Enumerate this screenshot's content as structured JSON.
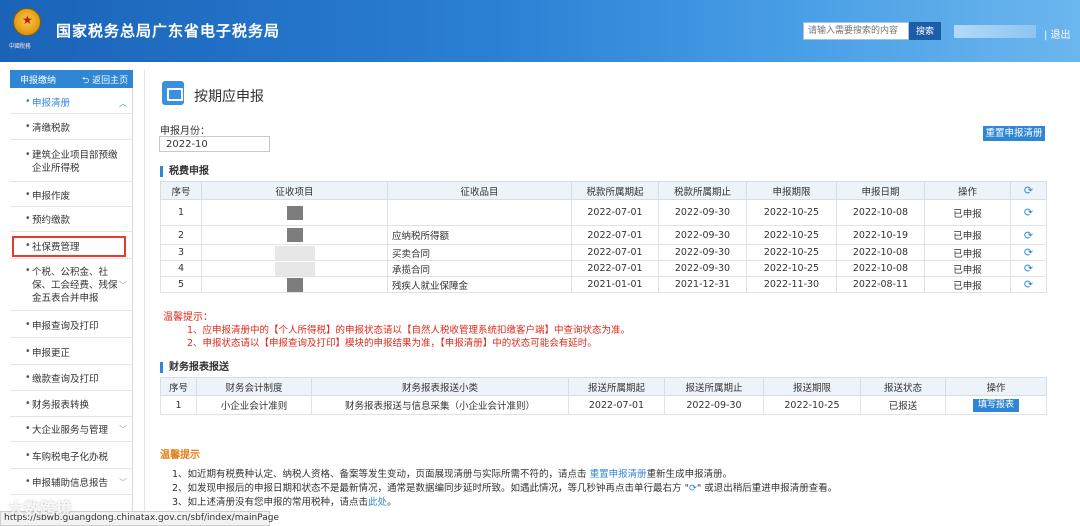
{
  "header": {
    "seal_text": "中國稅務",
    "title": "国家税务总局广东省电子税务局",
    "search_placeholder": "请输入需要搜索的内容",
    "search_button": "搜索",
    "logout": "| 退出"
  },
  "sidebar": {
    "head_left": "申报缴纳",
    "head_right": "返回主页",
    "items": [
      {
        "label": "申报清册"
      },
      {
        "label": "清缴税款"
      },
      {
        "label": "建筑企业项目部预缴企业所得税"
      },
      {
        "label": "申报作废"
      },
      {
        "label": "预约缴款"
      },
      {
        "label": "社保费管理"
      },
      {
        "label": "个税、公积金、社保、工会经费、残保金五表合并申报"
      },
      {
        "label": "申报查询及打印"
      },
      {
        "label": "申报更正"
      },
      {
        "label": "缴款查询及打印"
      },
      {
        "label": "财务报表转换"
      },
      {
        "label": "大企业服务与管理"
      },
      {
        "label": "车购税电子化办税"
      },
      {
        "label": "申报辅助信息报告"
      }
    ]
  },
  "main": {
    "page_title": "按期应申报",
    "month_label": "申报月份：",
    "month_value": "2022-10",
    "reset_button": "重置申报清册",
    "tax_section": "税费申报",
    "tax_headers": [
      "序号",
      "征收项目",
      "征收品目",
      "税款所属期起",
      "税款所属期止",
      "申报期限",
      "申报日期",
      "操作"
    ],
    "tax_rows": [
      {
        "no": "1",
        "item": "",
        "start": "2022-07-01",
        "end": "2022-09-30",
        "deadline": "2022-10-25",
        "date": "2022-10-08",
        "op": "已申报"
      },
      {
        "no": "2",
        "item": "应纳税所得额",
        "start": "2022-07-01",
        "end": "2022-09-30",
        "deadline": "2022-10-25",
        "date": "2022-10-19",
        "op": "已申报"
      },
      {
        "no": "3",
        "item": "买卖合同",
        "start": "2022-07-01",
        "end": "2022-09-30",
        "deadline": "2022-10-25",
        "date": "2022-10-08",
        "op": "已申报"
      },
      {
        "no": "4",
        "item": "承揽合同",
        "start": "2022-07-01",
        "end": "2022-09-30",
        "deadline": "2022-10-25",
        "date": "2022-10-08",
        "op": "已申报"
      },
      {
        "no": "5",
        "item": "残疾人就业保障金",
        "start": "2021-01-01",
        "end": "2021-12-31",
        "deadline": "2022-11-30",
        "date": "2022-08-11",
        "op": "已申报"
      }
    ],
    "warn_title": "温馨提示：",
    "warn_lines": [
      "1、应申报清册中的【个人所得税】的申报状态请以【自然人税收管理系统扣缴客户端】中查询状态为准。",
      "2、申报状态请以【申报查询及打印】模块的申报结果为准，【申报清册】中的状态可能会有延时。"
    ],
    "fin_section": "财务报表报送",
    "fin_headers": [
      "序号",
      "财务会计制度",
      "财务报表报送小类",
      "报送所属期起",
      "报送所属期止",
      "报送期限",
      "报送状态",
      "操作"
    ],
    "fin_rows": [
      {
        "no": "1",
        "system": "小企业会计准则",
        "type": "财务报表报送与信息采集（小企业会计准则）",
        "start": "2022-07-01",
        "end": "2022-09-30",
        "deadline": "2022-10-25",
        "status": "已报送",
        "op": "填写报表"
      }
    ],
    "tip_title": "温馨提示",
    "tip_lines": [
      {
        "a": "1、如近期有税费种认定、纳税人资格、备案等发生变动，页面展现清册与实际所需不符的，请点击 ",
        "link": "重置申报清册",
        "b": "重新生成申报清册。"
      },
      {
        "a": "2、如发现申报后的申报日期和状态不是最新情况，通常是数据编同步延时所致。如遇此情况，等几秒钟再点击单行最右方 \"",
        "link": "⟳",
        "b": "\" 或退出稍后重进申报清册查看。"
      },
      {
        "a": "3、如上述清册没有您申报的常用税种，请点击",
        "link": "此处",
        "b": "。"
      }
    ]
  },
  "status_bar": "https://sbwb.guangdong.chinatax.gov.cn/sbf/index/mainPage",
  "watermark": "大数跨境"
}
